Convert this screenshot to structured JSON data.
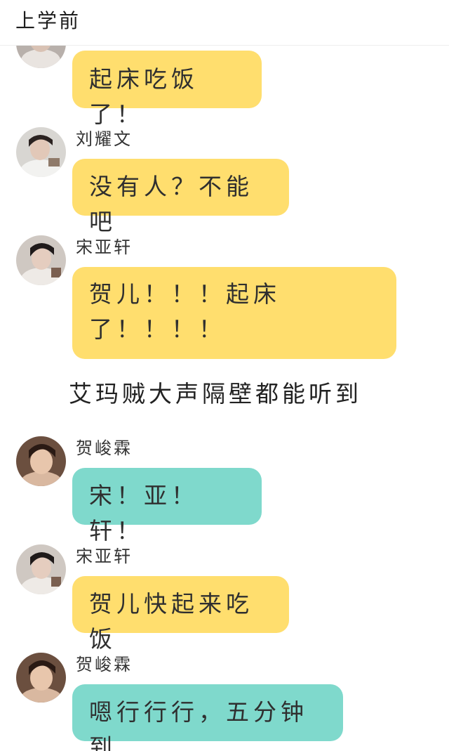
{
  "header": {
    "title": "上学前"
  },
  "colors": {
    "bubble_yellow": "#FFDE6E",
    "bubble_teal": "#7FD9CC",
    "background": "#FFFFFF"
  },
  "messages": [
    {
      "sender": "",
      "avatar": "avatar-photo",
      "text": "起床吃饭了！",
      "color": "yellow"
    },
    {
      "sender": "刘耀文",
      "avatar": "avatar-photo",
      "text": "没有人？不能吧",
      "color": "yellow"
    },
    {
      "sender": "宋亚轩",
      "avatar": "avatar-photo",
      "text_line1": "贺儿！！！起床",
      "text_line2": "了！！！！",
      "color": "yellow"
    },
    {
      "sender": "贺峻霖",
      "avatar": "avatar-photo",
      "text": "宋！亚！轩！",
      "color": "teal"
    },
    {
      "sender": "宋亚轩",
      "avatar": "avatar-photo",
      "text": "贺儿快起来吃饭",
      "color": "yellow"
    },
    {
      "sender": "贺峻霖",
      "avatar": "avatar-photo",
      "text": "嗯行行行，五分钟到",
      "color": "teal"
    }
  ],
  "narration": "艾玛贼大声隔壁都能听到"
}
